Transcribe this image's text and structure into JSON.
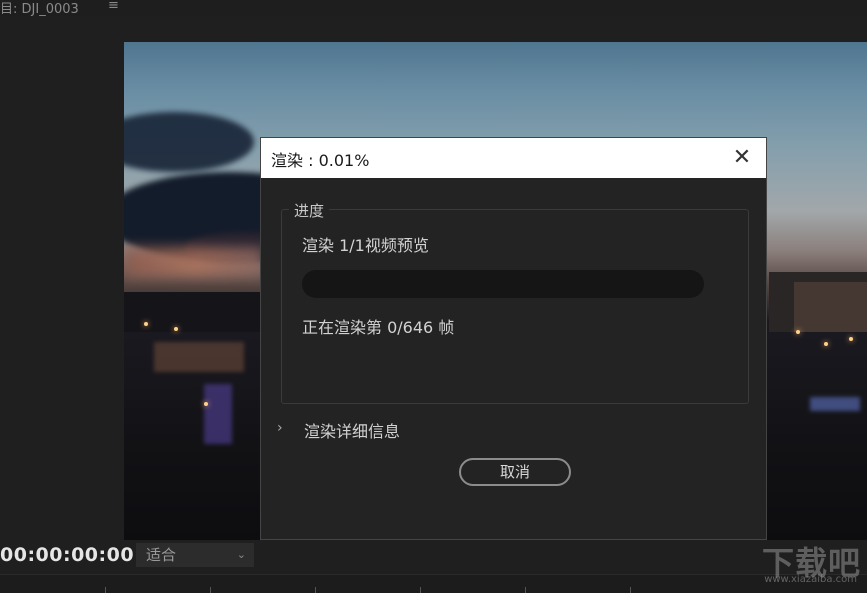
{
  "sequence": {
    "title": "目: DJI_0003",
    "menu_icon": "hamburger-icon"
  },
  "monitor": {
    "timecode": "00:00:00:00",
    "fit_label": "适合"
  },
  "dialog": {
    "title": "渲染 : 0.01%",
    "progress_group_label": "进度",
    "render_text": "渲染 1/1视频预览",
    "progress_fraction": 0.0001,
    "frame_text": "正在渲染第 0/646 帧",
    "details_label": "渲染详细信息",
    "cancel_label": "取消"
  },
  "watermark": {
    "text": "下载吧",
    "url": "www.xiazaiba.com"
  },
  "colors": {
    "dialog_bg": "#232323",
    "titlebar_bg": "#ffffff",
    "progress_track": "#151515",
    "panel_bg": "#1f1f1f"
  }
}
